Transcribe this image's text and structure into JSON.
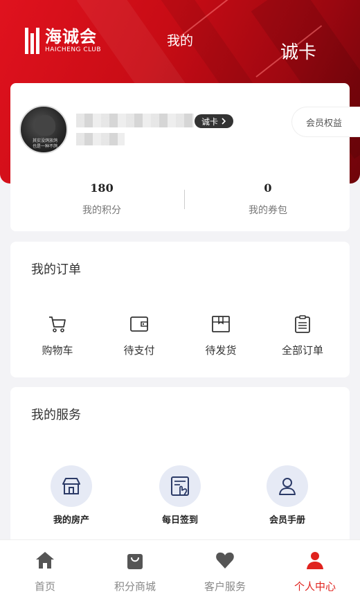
{
  "header": {
    "logo_cn": "海诚会",
    "logo_en": "HAICHENG CLUB",
    "title": "我的",
    "card_label": "诚卡"
  },
  "profile": {
    "avatar_caption_line1": "其实没鸽放鸽",
    "avatar_caption_line2": "也是一种不鸽",
    "badge_label": "诚卡",
    "benefits_label": "会员权益",
    "points_value": "180",
    "points_label": "我的积分",
    "coupons_value": "0",
    "coupons_label": "我的券包"
  },
  "orders": {
    "title": "我的订单",
    "items": [
      {
        "label": "购物车",
        "icon": "cart-icon"
      },
      {
        "label": "待支付",
        "icon": "wallet-icon"
      },
      {
        "label": "待发货",
        "icon": "box-icon"
      },
      {
        "label": "全部订单",
        "icon": "clipboard-icon"
      }
    ]
  },
  "services": {
    "title": "我的服务",
    "items": [
      {
        "label": "我的房产",
        "icon": "house-icon"
      },
      {
        "label": "每日签到",
        "icon": "checkin-icon"
      },
      {
        "label": "会员手册",
        "icon": "member-icon"
      }
    ]
  },
  "tabbar": {
    "items": [
      {
        "label": "首页",
        "icon": "home-icon"
      },
      {
        "label": "积分商城",
        "icon": "shopping-bag-icon"
      },
      {
        "label": "客户服务",
        "icon": "heart-icon"
      },
      {
        "label": "个人中心",
        "icon": "person-icon"
      }
    ],
    "active_index": 3
  },
  "colors": {
    "brand_red": "#e0121e",
    "active_tab": "#e0231e",
    "icon_navy": "#2b3a67"
  }
}
